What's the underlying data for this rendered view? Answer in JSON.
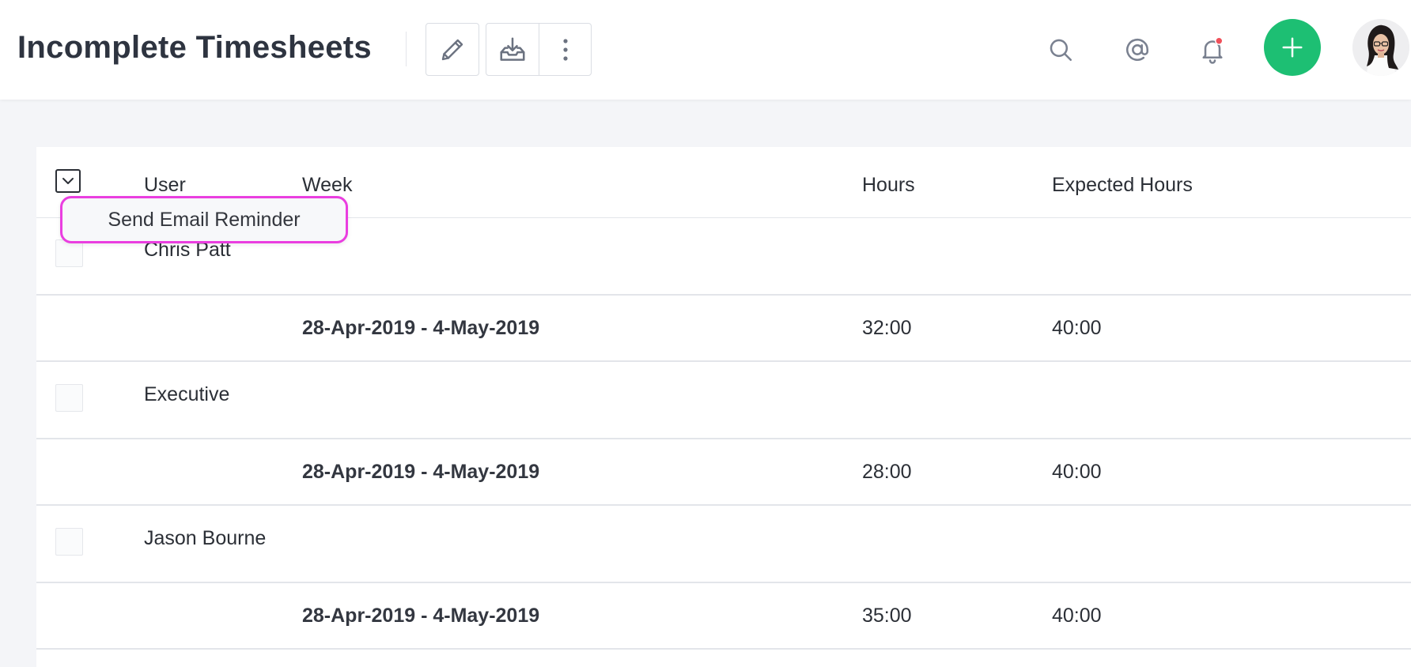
{
  "header": {
    "title": "Incomplete Timesheets",
    "icons": {
      "edit": "pencil-icon",
      "download": "download-tray-icon",
      "more": "vertical-ellipsis-icon",
      "search": "search-icon",
      "mentions": "at-sign-icon",
      "notifications": "bell-icon",
      "add": "plus-icon"
    },
    "accent_color": "#1dbf73",
    "notification_dot_color": "#f0505a"
  },
  "table": {
    "columns": {
      "user": "User",
      "week": "Week",
      "hours": "Hours",
      "expected_hours": "Expected Hours"
    },
    "rows": [
      {
        "user": "Chris Patt",
        "week": "28-Apr-2019 - 4-May-2019",
        "hours": "32:00",
        "expected_hours": "40:00"
      },
      {
        "user": "Executive",
        "week": "28-Apr-2019 - 4-May-2019",
        "hours": "28:00",
        "expected_hours": "40:00"
      },
      {
        "user": "Jason Bourne",
        "week": "28-Apr-2019 - 4-May-2019",
        "hours": "35:00",
        "expected_hours": "40:00"
      }
    ]
  },
  "bulk_menu": {
    "item_label": "Send Email Reminder",
    "highlight_color": "#ea3ee0"
  }
}
